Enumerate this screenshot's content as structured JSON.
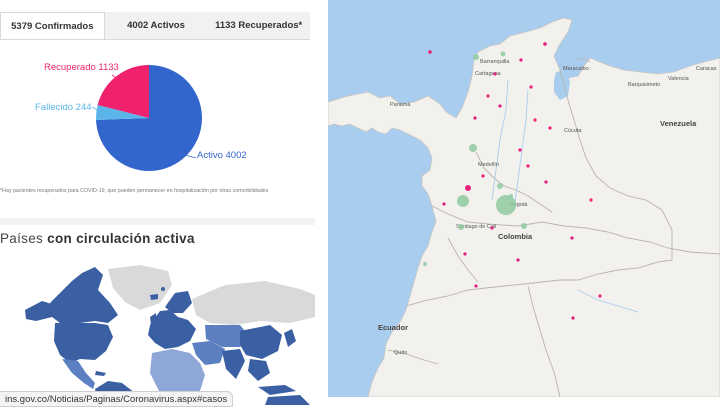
{
  "tabs": [
    {
      "label": "5379 Confirmados",
      "active": true
    },
    {
      "label": "4002 Activos",
      "active": false
    },
    {
      "label": "1133 Recuperados*",
      "active": false
    }
  ],
  "pie": {
    "slices": [
      {
        "label": "Activo 4002",
        "value": 4002,
        "color": "#3366cc"
      },
      {
        "label": "Recuperado 1133",
        "value": 1133,
        "color": "#f0226e"
      },
      {
        "label": "Fallecido 244",
        "value": 244,
        "color": "#5bb5ea"
      }
    ]
  },
  "note": "*Hay pacientes recuperados para COVID-19, que pueden permanecer en hospitalización por otras comorbilidades",
  "countries": {
    "title_light": "Países",
    "title_bold": "con circulación activa"
  },
  "url": "ins.gov.co/Noticias/Paginas/Coronavirus.aspx#casos",
  "map": {
    "labels": {
      "barranquilla": "Barranquilla",
      "cartagena": "Cartagena",
      "maracaibo": "Maracaibo",
      "panama": "Panamá",
      "barquisimeto": "Barquisimeto",
      "valencia": "Valencia",
      "caracas": "Caracas",
      "venezuela": "Venezuela",
      "cucuta": "Cúcuta",
      "medellin": "Medellín",
      "bogota": "Bogotá",
      "cali": "Santiago de Cali",
      "colombia": "Colombia",
      "ecuador": "Ecuador",
      "quito": "Quito"
    },
    "colors": {
      "water": "#a9cdee",
      "land": "#f2f1ee",
      "recovered": "#8fcaa0",
      "active": "#e8207a"
    }
  }
}
